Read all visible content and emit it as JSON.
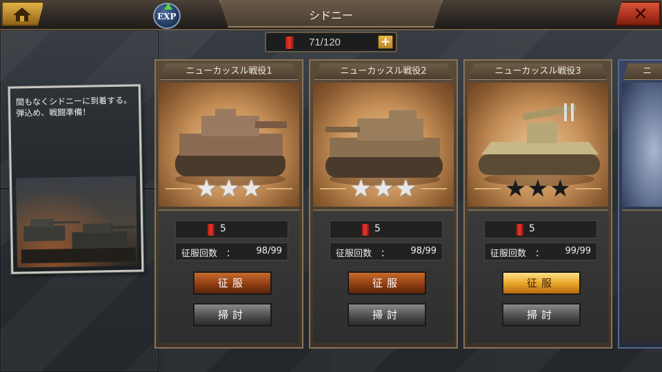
{
  "header": {
    "title": "シドニー",
    "exp_label": "EXP"
  },
  "fuel": {
    "value": "71/120",
    "plus_label": "+"
  },
  "intro": {
    "text": "間もなくシドニーに到着する。弾込め、戦闘準備！"
  },
  "missions": [
    {
      "title": "ニューカッスル戦役1",
      "stars_earned": 3,
      "star_type": "silver",
      "cost": "5",
      "count_label": "征服回数　：",
      "count_value": "98/99",
      "conquer_label": "征服",
      "sweep_label": "掃討"
    },
    {
      "title": "ニューカッスル戦役2",
      "stars_earned": 3,
      "star_type": "silver",
      "cost": "5",
      "count_label": "征服回数　：",
      "count_value": "98/99",
      "conquer_label": "征服",
      "sweep_label": "掃討"
    },
    {
      "title": "ニューカッスル戦役3",
      "stars_earned": 0,
      "star_type": "dark",
      "cost": "5",
      "count_label": "征服回数　：",
      "count_value": "99/99",
      "conquer_label": "征服",
      "sweep_label": "掃討"
    }
  ],
  "partial_card": {
    "title_fragment": "ニ"
  },
  "colors": {
    "home_button": "#d4a23c",
    "close_button": "#c0402a",
    "card_frame": "#8a7458",
    "conquer_active": "#e8a82a"
  }
}
